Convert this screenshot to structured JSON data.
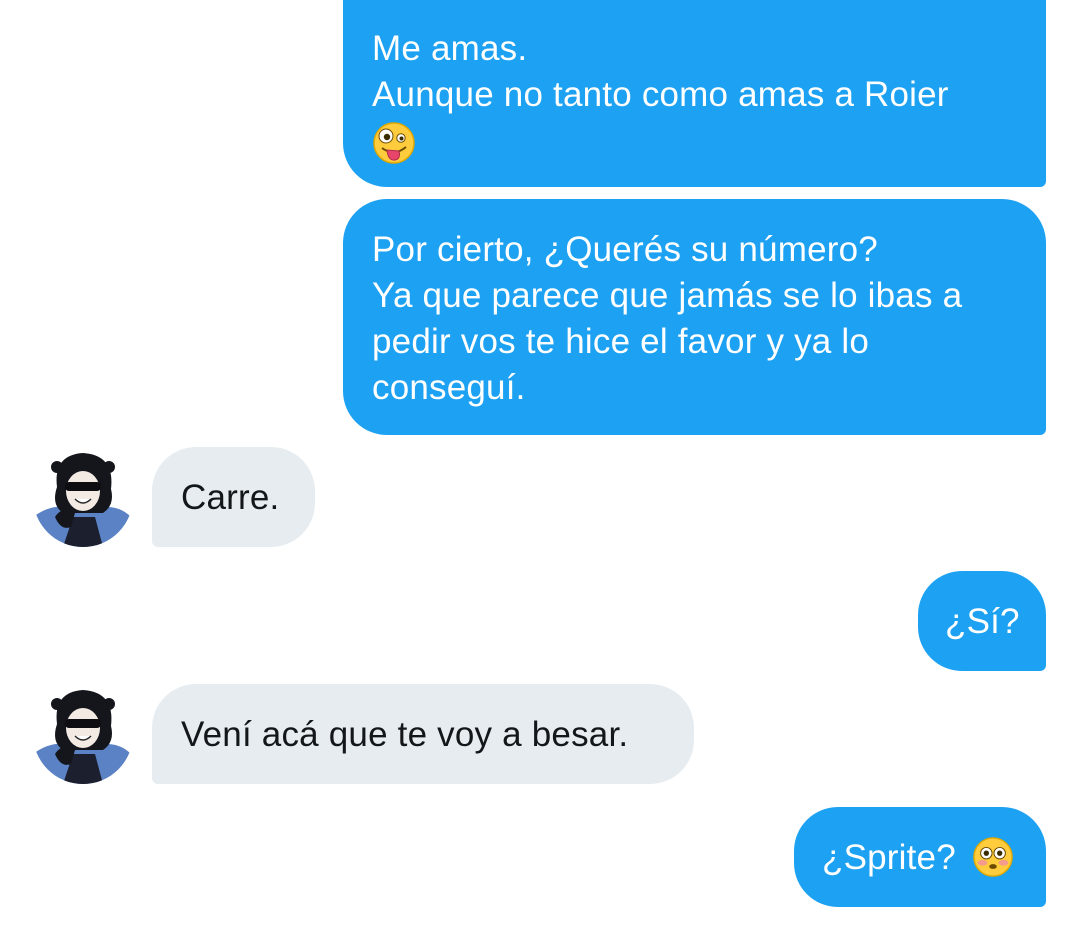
{
  "conversation": {
    "messages": [
      {
        "sender": "me",
        "lines": [
          "Me amas.",
          "Aunque no tanto como amas a Roier"
        ],
        "emoji": "zany-face"
      },
      {
        "sender": "me",
        "lines": [
          "Por cierto, ¿Querés su número?",
          "Ya que parece que jamás se lo ibas a",
          "pedir vos te hice el favor y ya lo",
          "conseguí."
        ]
      },
      {
        "sender": "contact",
        "text": "Carre."
      },
      {
        "sender": "me",
        "text": "¿Sí?"
      },
      {
        "sender": "contact",
        "text": "Vení acá que te voy a besar."
      },
      {
        "sender": "me",
        "text": "¿Sprite?",
        "emoji": "flushed-face"
      }
    ]
  },
  "colors": {
    "outgoing_bubble": "#1da1f2",
    "incoming_bubble": "#e6ecf0",
    "outgoing_text": "#ffffff",
    "incoming_text": "#14171a"
  },
  "icons": [
    "zany-face-emoji",
    "flushed-face-emoji",
    "avatar"
  ]
}
